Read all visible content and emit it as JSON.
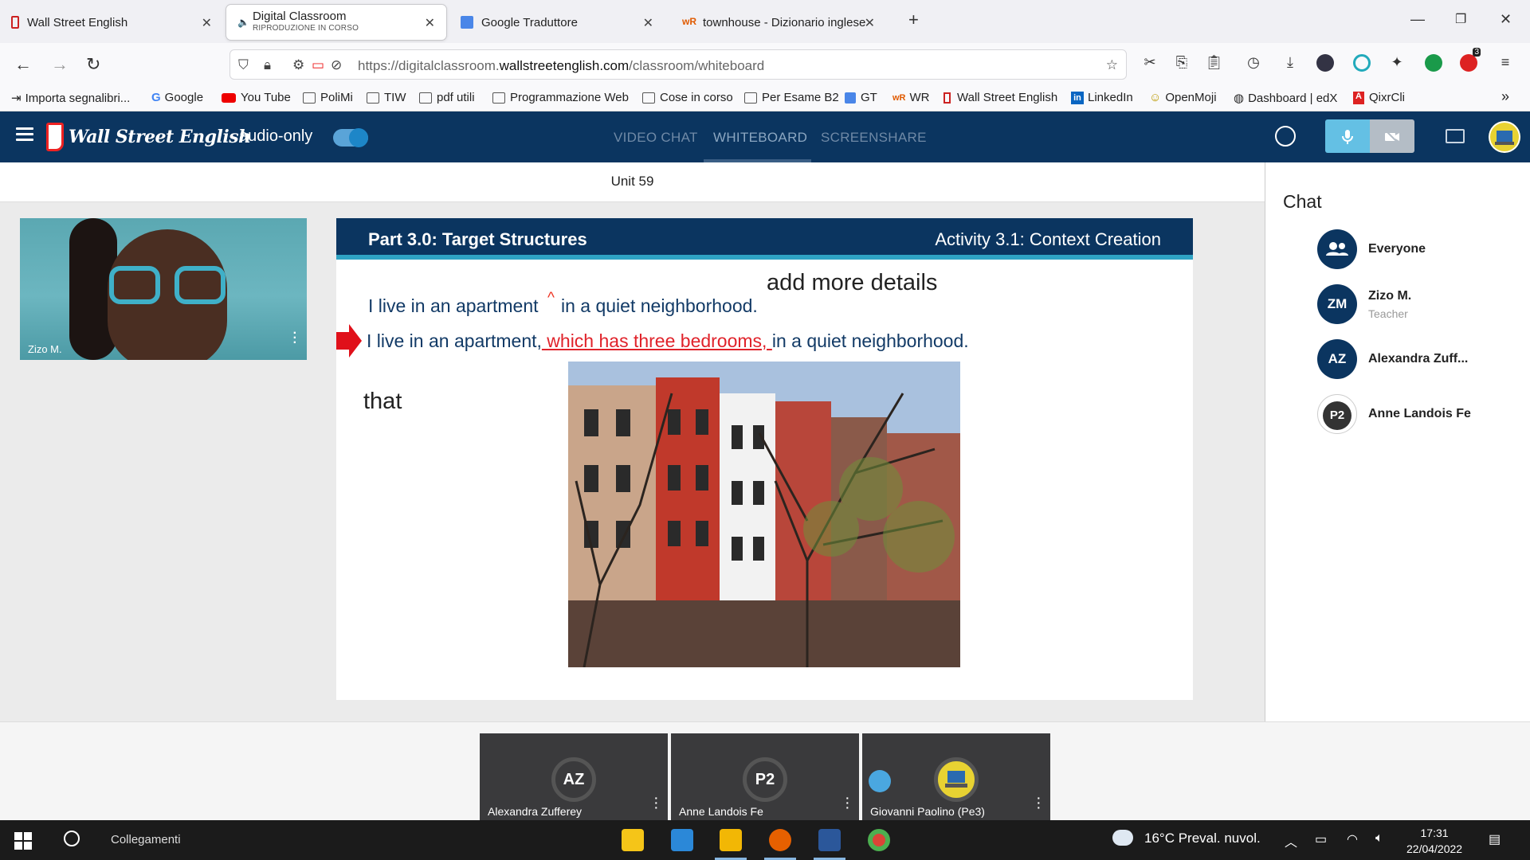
{
  "browser": {
    "tabs": [
      {
        "title": "Wall Street English",
        "subtitle": ""
      },
      {
        "title": "Digital Classroom",
        "subtitle": "RIPRODUZIONE IN CORSO"
      },
      {
        "title": "Google Traduttore",
        "subtitle": ""
      },
      {
        "title": "townhouse - Dizionario inglese",
        "subtitle": ""
      }
    ],
    "url_prefix": "https://digitalclassroom.",
    "url_domain": "wallstreetenglish.com",
    "url_path": "/classroom/whiteboard",
    "bookmarks": [
      "Importa segnalibri...",
      "Google",
      "You Tube",
      "PoliMi",
      "TIW",
      "pdf utili",
      "Programmazione Web",
      "Cose in corso",
      "Per Esame B2",
      "GT",
      "WR",
      "Wall Street English",
      "LinkedIn",
      "OpenMoji",
      "Dashboard | edX",
      "QixrCli"
    ],
    "extension_badge": "3"
  },
  "app": {
    "logo_text": "Wall Street English",
    "audio_only_label": "audio-only",
    "tabs": [
      "VIDEO CHAT",
      "WHITEBOARD",
      "SCREENSHARE"
    ],
    "unit_title": "Unit 59"
  },
  "video": {
    "participant_name": "Zizo M."
  },
  "slide": {
    "part_title": "Part 3.0: Target Structures",
    "activity_title": "Activity 3.1: Context Creation",
    "sentence1": "I live in an apartment",
    "sentence1_end": "in a quiet neighborhood.",
    "sentence2_start": "I live in an apartment,",
    "sentence2_clause": " which has three bedrooms,  ",
    "sentence2_end": "in a quiet neighborhood.",
    "annotation_details": "add more details",
    "annotation_caret": "^",
    "annotation_that": "that"
  },
  "chat": {
    "title": "Chat",
    "entries": [
      {
        "avatar": "",
        "name": "Everyone",
        "role": ""
      },
      {
        "avatar": "ZM",
        "name": "Zizo M.",
        "role": "Teacher"
      },
      {
        "avatar": "AZ",
        "name": "Alexandra Zuff...",
        "role": ""
      },
      {
        "avatar": "P2",
        "name": "Anne Landois Fe",
        "role": ""
      }
    ]
  },
  "participants": [
    {
      "avatar": "AZ",
      "name": "Alexandra Zufferey"
    },
    {
      "avatar": "P2",
      "name": "Anne Landois Fe"
    },
    {
      "avatar": "",
      "name": "Giovanni Paolino (Pe3)"
    }
  ],
  "taskbar": {
    "search_label": "Collegamenti",
    "weather": "16°C  Preval. nuvol.",
    "time": "17:31",
    "date": "22/04/2022"
  },
  "colors": {
    "brand_navy": "#0b3560",
    "accent_teal": "#2fa3c4",
    "annotation_red": "#e0222a",
    "mic_active": "#64c0e4"
  }
}
